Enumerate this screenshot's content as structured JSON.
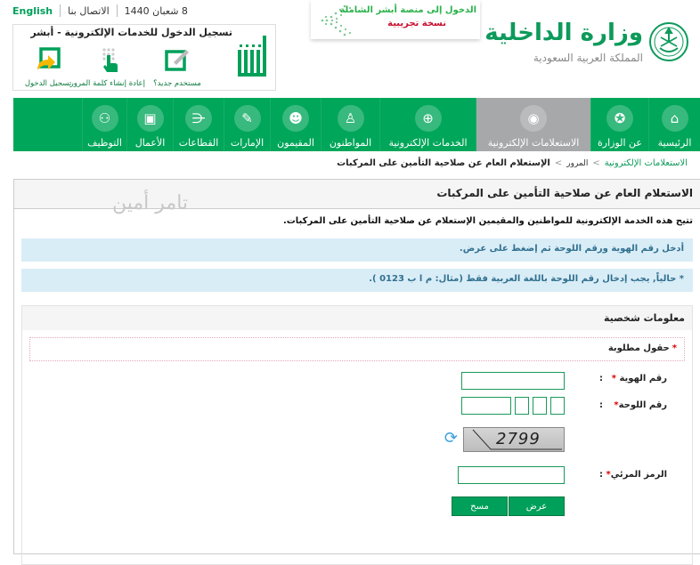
{
  "top_links": {
    "english": "English",
    "contact": "الاتصال بنا",
    "date": "8 شعبان 1440"
  },
  "login_box": {
    "title": "تسجيل الدخول للخدمات الإلكترونية - أبشر",
    "logo": "أبشر",
    "actions": [
      {
        "label": "مستخدم جديد؟",
        "icon": "new-user-icon"
      },
      {
        "label": "إعادة إنشاء كلمة المرور",
        "icon": "reset-password-icon"
      },
      {
        "label": "تسجيل الدخول",
        "icon": "login-icon"
      }
    ]
  },
  "banner": {
    "line1": "الدخول إلى منصة أبشر الشاملة",
    "line2": "نسخة تجريبية"
  },
  "ministry": {
    "name": "وزارة الداخلية",
    "country": "المملكة العربية السعودية"
  },
  "nav": {
    "items": [
      {
        "label": "الرئيسية",
        "icon": "home-icon",
        "glyph": "⌂",
        "active": false
      },
      {
        "label": "عن الوزارة",
        "icon": "emblem-icon",
        "glyph": "✪",
        "active": false
      },
      {
        "label": "الاستعلامات الإلكترونية",
        "icon": "inquiries-icon",
        "glyph": "◉",
        "active": true
      },
      {
        "label": "الخدمات الإلكترونية",
        "icon": "globe-icon",
        "glyph": "⊕",
        "active": false
      },
      {
        "label": "المواطنون",
        "icon": "citizen-icon",
        "glyph": "♙",
        "active": false
      },
      {
        "label": "المقيمون",
        "icon": "residents-icon",
        "glyph": "☻",
        "active": false
      },
      {
        "label": "الإمارات",
        "icon": "emirates-icon",
        "glyph": "✎",
        "active": false
      },
      {
        "label": "القطاعات",
        "icon": "sectors-icon",
        "glyph": "⋲",
        "active": false
      },
      {
        "label": "الأعمال",
        "icon": "briefcase-icon",
        "glyph": "▣",
        "active": false
      },
      {
        "label": "التوظيف",
        "icon": "employment-icon",
        "glyph": "⚇",
        "active": false
      }
    ]
  },
  "breadcrumb": {
    "items": [
      "الاستعلامات الإلكترونية",
      "المرور",
      "الإستعلام العام عن صلاحية التأمين على المركبات"
    ],
    "separator": ">"
  },
  "page": {
    "title": "الاستعلام العام عن صلاحية التأمين على المركبات",
    "watermark": "تامر أمين",
    "intro": "تتيح هذه الخدمة الإلكترونية للمواطنين والمقيمين الإستعلام عن صلاحية التأمين على المركبات.",
    "info1": "أدخل رقم الهوية ورقم اللوحة ثم إضغط على عرض.",
    "info2": "* حالياً, يجب إدخال رقم اللوحة باللغة العربية فقط (مثال: م ا ب 0123 )."
  },
  "form": {
    "section_title": "معلومات شخصية",
    "required_note": "حقول مطلوبة",
    "required_star": "*",
    "id_label": "رقم الهوية",
    "plate_label": "رقم اللوحة",
    "captcha_label": "الرمز المرئي",
    "colon": ":",
    "id_value": "",
    "plate_number_value": "",
    "plate_letter1": "",
    "plate_letter2": "",
    "plate_letter3": "",
    "captcha_value": "",
    "captcha_image_text": "2799",
    "submit_label": "عرض",
    "clear_label": "مسح"
  }
}
